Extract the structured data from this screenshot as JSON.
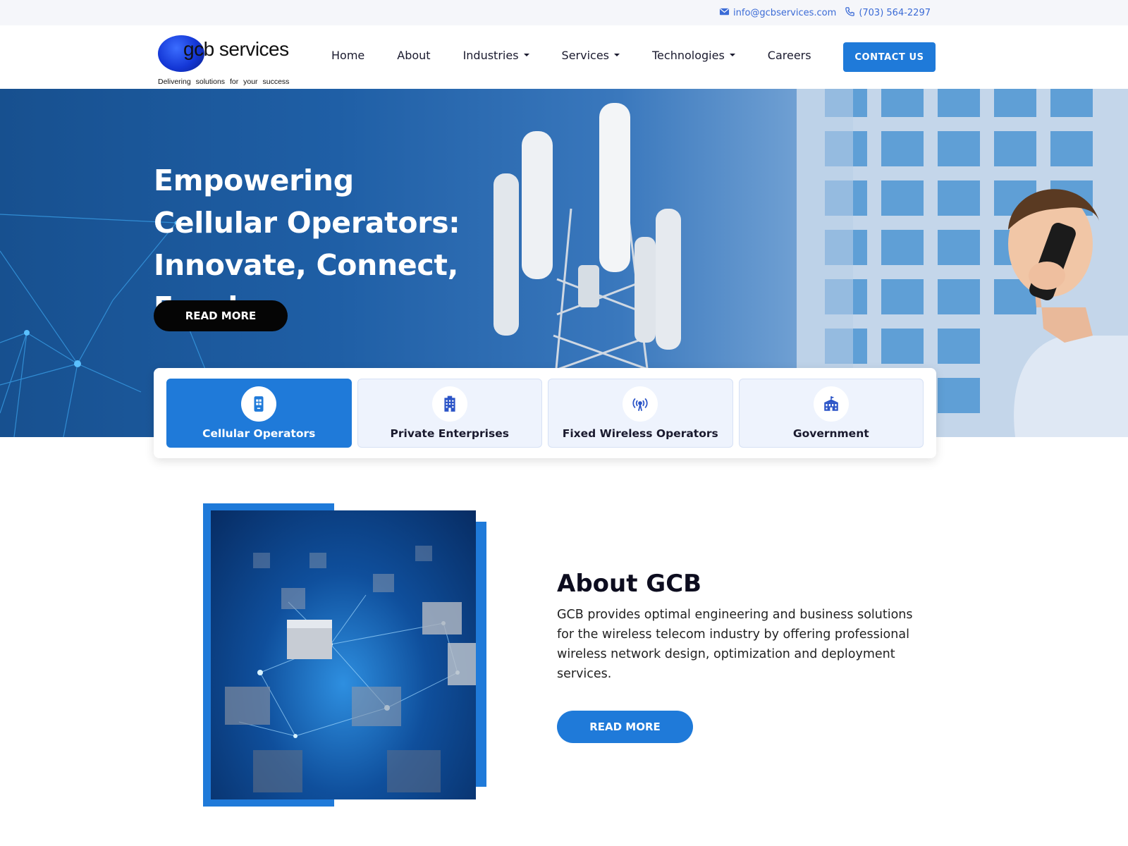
{
  "topbar": {
    "email": "info@gcbservices.com",
    "phone": "(703) 564-2297",
    "icons": [
      "mail-icon",
      "phone-icon"
    ]
  },
  "brand": {
    "logo_text": "gcb services",
    "tagline": "Delivering solutions for your success",
    "logo_color": "#1437d6"
  },
  "nav": {
    "items": [
      {
        "label": "Home",
        "dropdown": false
      },
      {
        "label": "About",
        "dropdown": false
      },
      {
        "label": "Industries",
        "dropdown": true
      },
      {
        "label": "Services",
        "dropdown": true
      },
      {
        "label": "Technologies",
        "dropdown": true
      },
      {
        "label": "Careers",
        "dropdown": false
      }
    ],
    "cta": "CONTACT US"
  },
  "hero": {
    "title": "Empowering Cellular Operators: Innovate, Connect, Excel",
    "button": "READ MORE"
  },
  "industries": {
    "active_index": 0,
    "items": [
      {
        "label": "Cellular Operators",
        "icon": "mobile-phone-icon"
      },
      {
        "label": "Private Enterprises",
        "icon": "office-building-icon"
      },
      {
        "label": "Fixed Wireless Operators",
        "icon": "wireless-tower-icon"
      },
      {
        "label": "Government",
        "icon": "government-building-icon"
      }
    ]
  },
  "about": {
    "title": "About GCB",
    "text": "GCB provides optimal engineering and business solutions for the wireless telecom industry by offering professional wireless network design, optimization and deployment services.",
    "button": "READ MORE"
  },
  "colors": {
    "accent": "#1f7ad9",
    "dark_button": "#050505",
    "link": "#3b6bd6"
  }
}
